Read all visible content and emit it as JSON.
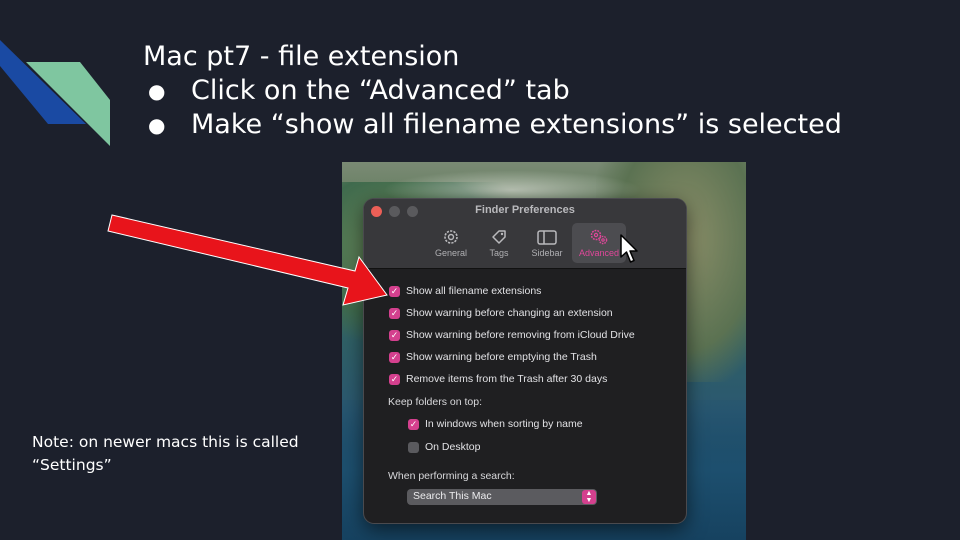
{
  "slide": {
    "title": "Mac pt7 - file extension",
    "bullets": [
      "Click on the “Advanced” tab",
      "Make “show all filename extensions” is selected"
    ],
    "note": "Note: on newer macs this is called “Settings”"
  },
  "window": {
    "title": "Finder Preferences",
    "tabs": [
      {
        "label": "General",
        "icon": "gear-icon",
        "active": false
      },
      {
        "label": "Tags",
        "icon": "tag-icon",
        "active": false
      },
      {
        "label": "Sidebar",
        "icon": "sidebar-icon",
        "active": false
      },
      {
        "label": "Advanced",
        "icon": "advanced-gears-icon",
        "active": true
      }
    ],
    "options": [
      {
        "label": "Show all filename extensions",
        "checked": true
      },
      {
        "label": "Show warning before changing an extension",
        "checked": true
      },
      {
        "label": "Show warning before removing from iCloud Drive",
        "checked": true
      },
      {
        "label": "Show warning before emptying the Trash",
        "checked": true
      },
      {
        "label": "Remove items from the Trash after 30 days",
        "checked": true
      }
    ],
    "keep_folders_label": "Keep folders on top:",
    "keep_folders_options": [
      {
        "label": "In windows when sorting by name",
        "checked": true
      },
      {
        "label": "On Desktop",
        "checked": false
      }
    ],
    "search_label": "When performing a search:",
    "search_value": "Search This Mac"
  },
  "colors": {
    "background": "#1c202c",
    "accent": "#d4408e",
    "arrow": "#e8141b",
    "deco_blue": "#1a4aa3",
    "deco_green": "#7fc6a0"
  }
}
